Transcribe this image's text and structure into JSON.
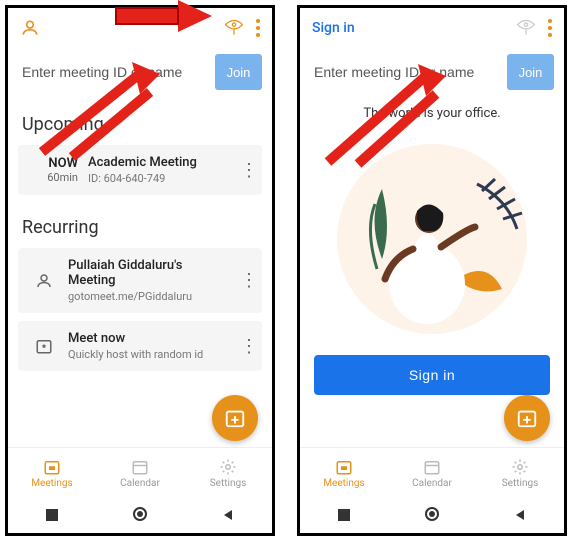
{
  "left": {
    "search_placeholder": "Enter meeting ID or name",
    "join_label": "Join",
    "upcoming_title": "Upcoming",
    "now_label": "NOW",
    "now_duration": "60min",
    "meeting_title": "Academic Meeting",
    "meeting_id": "ID: 604-640-749",
    "recurring_title": "Recurring",
    "rec1_title": "Pullaiah Giddaluru's Meeting",
    "rec1_sub": "gotomeet.me/PGiddaluru",
    "rec2_title": "Meet now",
    "rec2_sub": "Quickly host with random id",
    "tabs": {
      "meetings": "Meetings",
      "calendar": "Calendar",
      "settings": "Settings"
    }
  },
  "right": {
    "signin_link": "Sign in",
    "search_placeholder": "Enter meeting ID or name",
    "join_label": "Join",
    "hero": "The world is your office.",
    "signin_btn": "Sign in",
    "tabs": {
      "meetings": "Meetings",
      "calendar": "Calendar",
      "settings": "Settings"
    }
  },
  "colors": {
    "accent": "#e6911a",
    "primary": "#1a73e8",
    "annotation": "#e3231a"
  }
}
